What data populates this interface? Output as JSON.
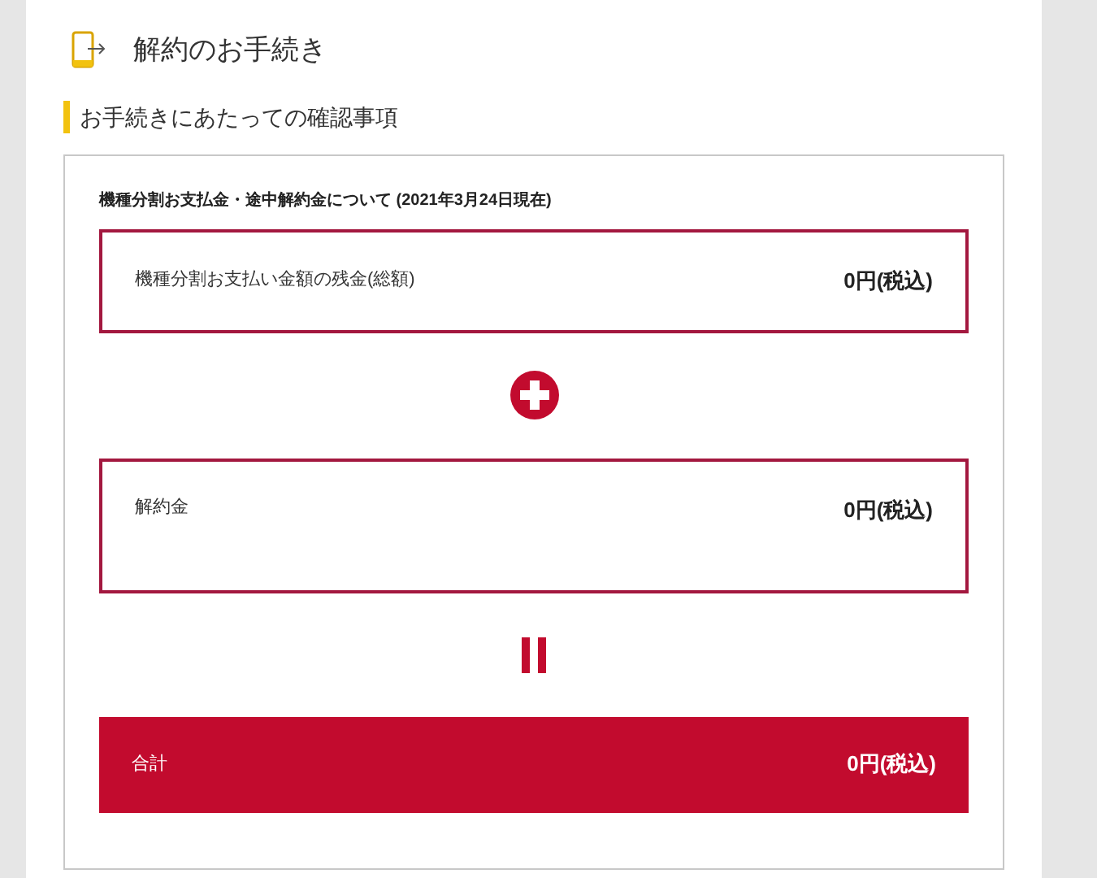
{
  "header": {
    "title": "解約のお手続き"
  },
  "section": {
    "heading": "お手続きにあたっての確認事項"
  },
  "summary": {
    "caption": "機種分割お支払金・途中解約金について (2021年3月24日現在)",
    "rows": [
      {
        "kind": "amount",
        "label": "機種分割お支払い金額の残金(総額)",
        "value": "0円(税込)"
      },
      {
        "kind": "plus"
      },
      {
        "kind": "amount",
        "label": "解約金",
        "value": "0円(税込)"
      },
      {
        "kind": "equals"
      },
      {
        "kind": "total",
        "label": "合計",
        "value": "0円(税込)"
      }
    ]
  }
}
